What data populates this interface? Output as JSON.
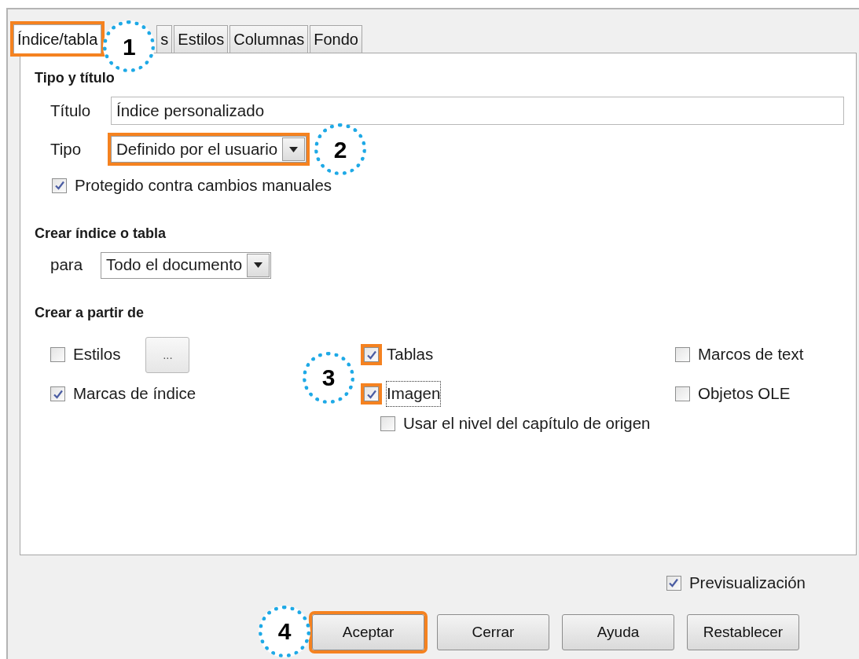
{
  "tabs": [
    {
      "label": "Índice/tabla",
      "selected": true,
      "highlighted": true,
      "callout": "1"
    },
    {
      "label": "s",
      "selected": false,
      "highlighted": false
    },
    {
      "label": "Estilos",
      "selected": false,
      "highlighted": false
    },
    {
      "label": "Columnas",
      "selected": false,
      "highlighted": false
    },
    {
      "label": "Fondo",
      "selected": false,
      "highlighted": false
    }
  ],
  "type_and_title": {
    "heading": "Tipo y título",
    "title_field": {
      "label": "Título",
      "value": "Índice personalizado"
    },
    "type_field": {
      "label": "Tipo",
      "value": "Definido por el usuario",
      "highlighted": true,
      "callout": "2"
    },
    "protected": {
      "label": "Protegido contra cambios manuales",
      "checked": true
    }
  },
  "create_index": {
    "heading": "Crear índice o tabla",
    "scope_field": {
      "label": "para",
      "value": "Todo el documento"
    }
  },
  "create_from": {
    "heading": "Crear a partir de",
    "columns": [
      {
        "options": [
          {
            "label": "Estilos",
            "checked": false,
            "highlighted": false,
            "focused": false,
            "button": "..."
          },
          {
            "label": "Marcas de índice",
            "checked": true,
            "highlighted": false,
            "focused": false
          }
        ]
      },
      {
        "callout": "3",
        "options": [
          {
            "label": "Tablas",
            "checked": true,
            "highlighted": true,
            "focused": false
          },
          {
            "label": "Imagen",
            "checked": true,
            "highlighted": true,
            "focused": true,
            "children": [
              {
                "label": "Usar el nivel del capítulo de origen",
                "checked": false,
                "highlighted": false,
                "focused": false
              }
            ]
          }
        ]
      },
      {
        "options": [
          {
            "label": "Marcos de text",
            "checked": false,
            "highlighted": false,
            "focused": false
          },
          {
            "label": "Objetos OLE",
            "checked": false,
            "highlighted": false,
            "focused": false
          }
        ]
      }
    ]
  },
  "preview": {
    "label": "Previsualización",
    "checked": true
  },
  "buttons": [
    {
      "label": "Aceptar",
      "highlighted": true,
      "callout": "4"
    },
    {
      "label": "Cerrar",
      "highlighted": false
    },
    {
      "label": "Ayuda",
      "highlighted": false
    },
    {
      "label": "Restablecer",
      "highlighted": false
    }
  ]
}
